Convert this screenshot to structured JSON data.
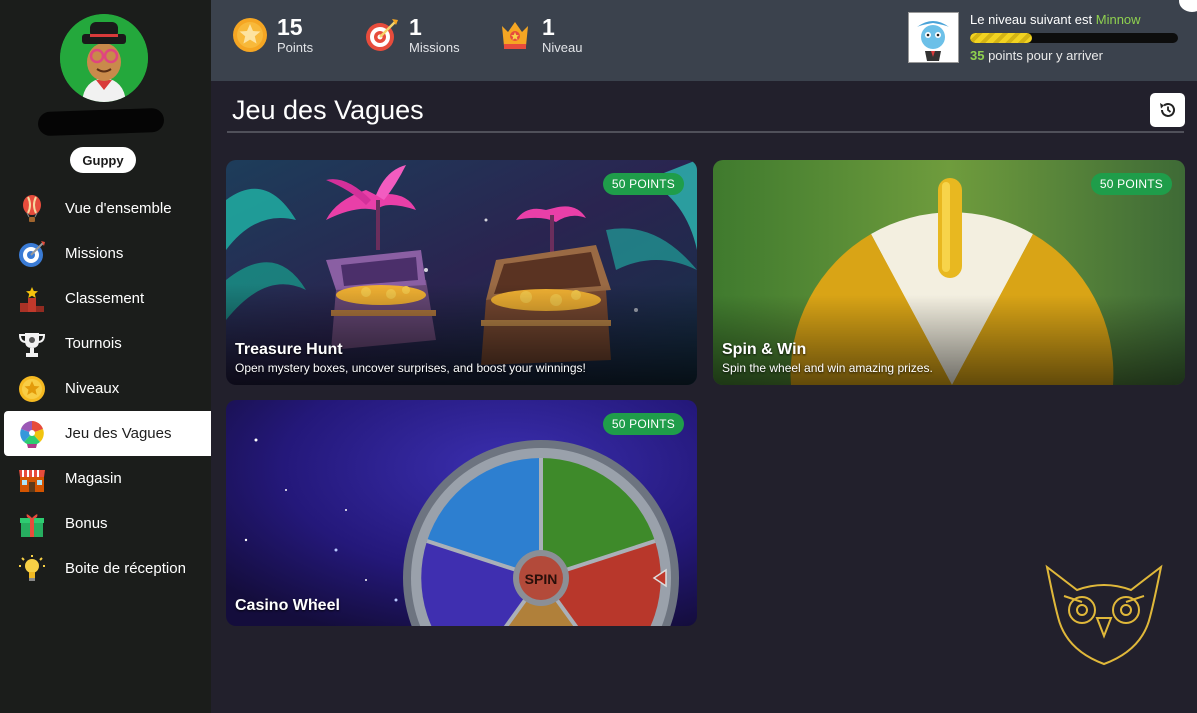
{
  "sidebar": {
    "rank": "Guppy",
    "items": [
      {
        "label": "Vue d'ensemble",
        "icon": "hot-air-balloon-icon"
      },
      {
        "label": "Missions",
        "icon": "target-icon"
      },
      {
        "label": "Classement",
        "icon": "podium-icon"
      },
      {
        "label": "Tournois",
        "icon": "trophy-icon"
      },
      {
        "label": "Niveaux",
        "icon": "star-medal-icon"
      },
      {
        "label": "Jeu des Vagues",
        "icon": "prize-wheel-icon",
        "active": true
      },
      {
        "label": "Magasin",
        "icon": "store-icon"
      },
      {
        "label": "Bonus",
        "icon": "gift-icon"
      },
      {
        "label": "Boite de réception",
        "icon": "lightbulb-icon"
      }
    ]
  },
  "topbar": {
    "stats": [
      {
        "value": "15",
        "label": "Points",
        "icon": "star-coin-icon"
      },
      {
        "value": "1",
        "label": "Missions",
        "icon": "dart-target-icon"
      },
      {
        "value": "1",
        "label": "Niveau",
        "icon": "level-badge-icon"
      }
    ],
    "next_level": {
      "prefix": "Le niveau suivant est ",
      "level_name": "Minnow",
      "points_needed": "35",
      "suffix": " points pour y arriver",
      "progress": 0.3
    }
  },
  "main": {
    "title": "Jeu des Vagues",
    "cards": [
      {
        "title": "Treasure Hunt",
        "badge": "50 POINTS",
        "description": "Open mystery boxes, uncover surprises, and boost your winnings!"
      },
      {
        "title": "Spin & Win",
        "badge": "50 POINTS",
        "description": "Spin the wheel and win amazing prizes."
      },
      {
        "title": "Casino Wheel",
        "badge": "50 POINTS",
        "description": "",
        "wheel_center": "SPIN"
      }
    ]
  },
  "colors": {
    "accent_green": "#1f9d4a",
    "level_green": "#8fd14f",
    "sidebar_bg": "#1b1d1b",
    "topbar_bg": "#3b424d",
    "main_bg": "#22202c"
  }
}
